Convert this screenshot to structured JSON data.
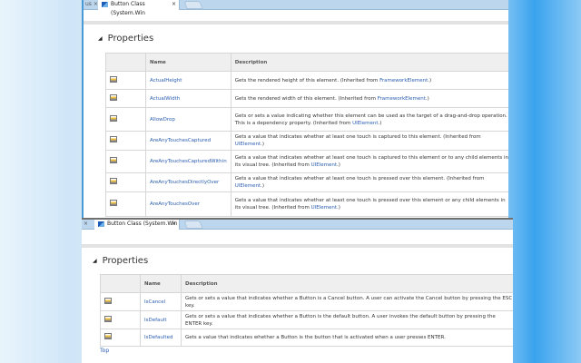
{
  "top_window": {
    "prev_tab_fragment": "us",
    "tab_title": "Button Class (System.Win",
    "section_title": "Properties",
    "columns": [
      "",
      "Name",
      "Description"
    ],
    "rows": [
      {
        "name": "ActualHeight",
        "desc": "Gets the rendered height of this element. (Inherited from ",
        "link": "FrameworkElement",
        "end": ".)"
      },
      {
        "name": "ActualWidth",
        "desc": "Gets the rendered width of this element. (Inherited from ",
        "link": "FrameworkElement",
        "end": ".)"
      },
      {
        "name": "AllowDrop",
        "desc": "Gets or sets a value indicating whether this element can be used as the target of a drag-and-drop operation. This is a dependency property. (Inherited from ",
        "link": "UIElement",
        "end": ".)"
      },
      {
        "name": "AreAnyTouchesCaptured",
        "desc": "Gets a value that indicates whether at least one touch is captured to this element. (Inherited from ",
        "link": "UIElement",
        "end": ".)"
      },
      {
        "name": "AreAnyTouchesCapturedWithin",
        "desc": "Gets a value that indicates whether at least one touch is captured to this element or to any child elements in its visual tree. (Inherited from ",
        "link": "UIElement",
        "end": ".)"
      },
      {
        "name": "AreAnyTouchesDirectlyOver",
        "desc": "Gets a value that indicates whether at least one touch is pressed over this element. (Inherited from ",
        "link": "UIElement",
        "end": ".)"
      },
      {
        "name": "AreAnyTouchesOver",
        "desc": "Gets a value that indicates whether at least one touch is pressed over this element or any child elements in its visual tree. (Inherited from ",
        "link": "UIElement",
        "end": ".)"
      }
    ]
  },
  "bottom_window": {
    "prev_tab_fragment": "×",
    "tab_title": "Button Class (System.Win",
    "section_title": "Properties",
    "columns": [
      "",
      "Name",
      "Description"
    ],
    "rows": [
      {
        "name": "IsCancel",
        "desc": "Gets or sets a value that indicates whether a Button is a Cancel button. A user can activate the Cancel button by pressing the ESC key."
      },
      {
        "name": "IsDefault",
        "desc": "Gets or sets a value that indicates whether a Button is the default button. A user invokes the default button by pressing the ENTER key."
      },
      {
        "name": "IsDefaulted",
        "desc": "Gets a value that indicates whether a Button is the button that is activated when a user presses ENTER."
      }
    ],
    "top_link": "Top"
  },
  "icons": {
    "tab": "browser-page-icon",
    "row": "property-icon",
    "close": "close-icon",
    "collapse": "collapse-triangle-icon"
  }
}
